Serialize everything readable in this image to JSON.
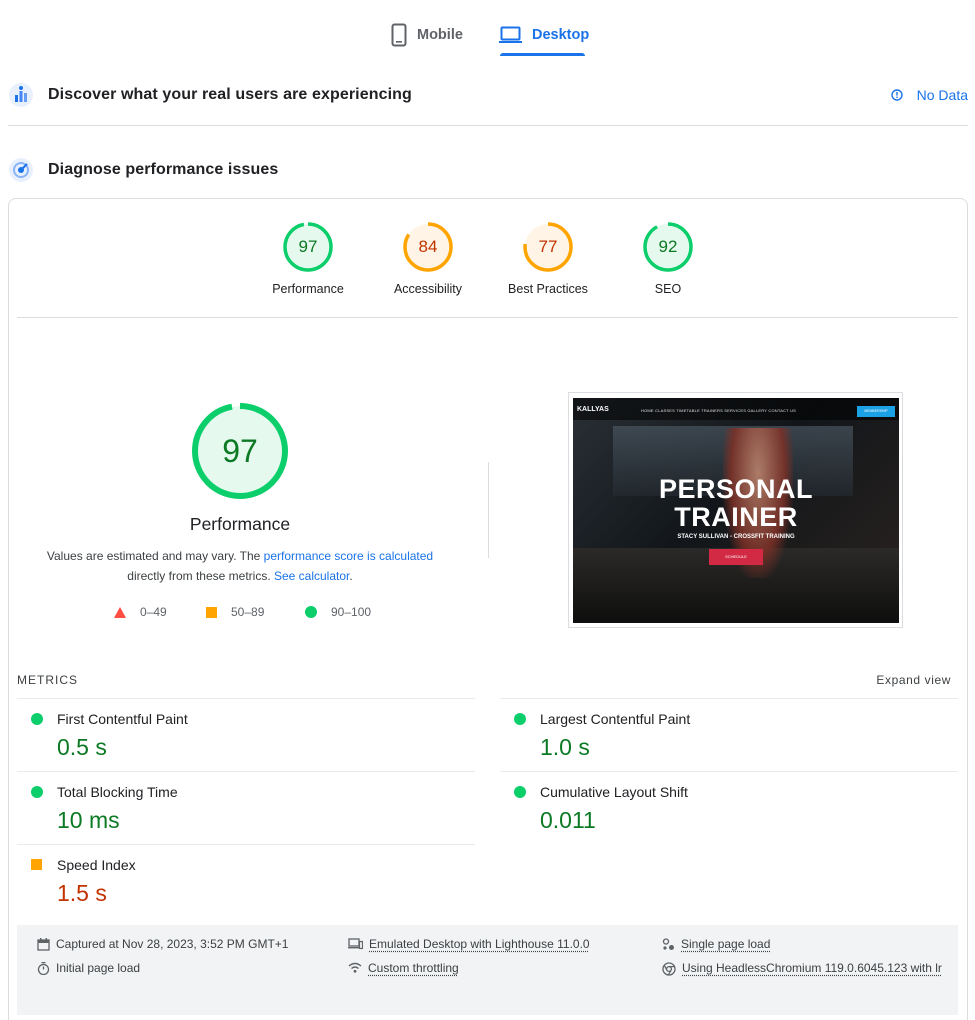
{
  "tabs": {
    "mobile": "Mobile",
    "desktop": "Desktop"
  },
  "crux": {
    "title": "Discover what your real users are experiencing",
    "status": "No Data"
  },
  "diagnose": {
    "title": "Diagnose performance issues"
  },
  "scores": [
    {
      "label": "Performance",
      "value": "97",
      "fraction": 0.97,
      "color": "#0cce6b"
    },
    {
      "label": "Accessibility",
      "value": "84",
      "fraction": 0.84,
      "color": "#ffa400"
    },
    {
      "label": "Best Practices",
      "value": "77",
      "fraction": 0.77,
      "color": "#ffa400"
    },
    {
      "label": "SEO",
      "value": "92",
      "fraction": 0.92,
      "color": "#0cce6b"
    }
  ],
  "performance": {
    "value": "97",
    "fraction": 0.97,
    "title": "Performance",
    "desc_prefix": "Values are estimated and may vary. The ",
    "desc_link": "performance score is calculated",
    "desc_mid": "directly from these metrics. ",
    "desc_link2": "See calculator",
    "desc_end": "."
  },
  "legend": {
    "low": "0–49",
    "mid": "50–89",
    "high": "90–100"
  },
  "screenshot": {
    "logo": "KALLYAS",
    "nav": "HOME   CLASSES   TIMETABLE   TRAINERS   SERVICES   GALLERY   CONTACT US",
    "nav_button": "MEMBERSHIP",
    "hero_line1": "PERSONAL",
    "hero_line2": "TRAINER",
    "hero_sub": "STACY SULLIVAN - CROSSFIT TRAINING",
    "hero_button": "SCHEDULE"
  },
  "metrics": {
    "label": "METRICS",
    "expand": "Expand view",
    "items": [
      {
        "name": "First Contentful Paint",
        "value": "0.5 s"
      },
      {
        "name": "Largest Contentful Paint",
        "value": "1.0 s"
      },
      {
        "name": "Total Blocking Time",
        "value": "10 ms"
      },
      {
        "name": "Cumulative Layout Shift",
        "value": "0.011"
      },
      {
        "name": "Speed Index",
        "value": "1.5 s"
      }
    ]
  },
  "runtime": {
    "captured": "Captured at Nov 28, 2023, 3:52 PM GMT+1",
    "initial": "Initial page load",
    "emulated": "Emulated Desktop with Lighthouse 11.0.0",
    "throttling": "Custom throttling",
    "single": "Single page load",
    "browser": "Using HeadlessChromium 119.0.6045.123 with lr"
  }
}
